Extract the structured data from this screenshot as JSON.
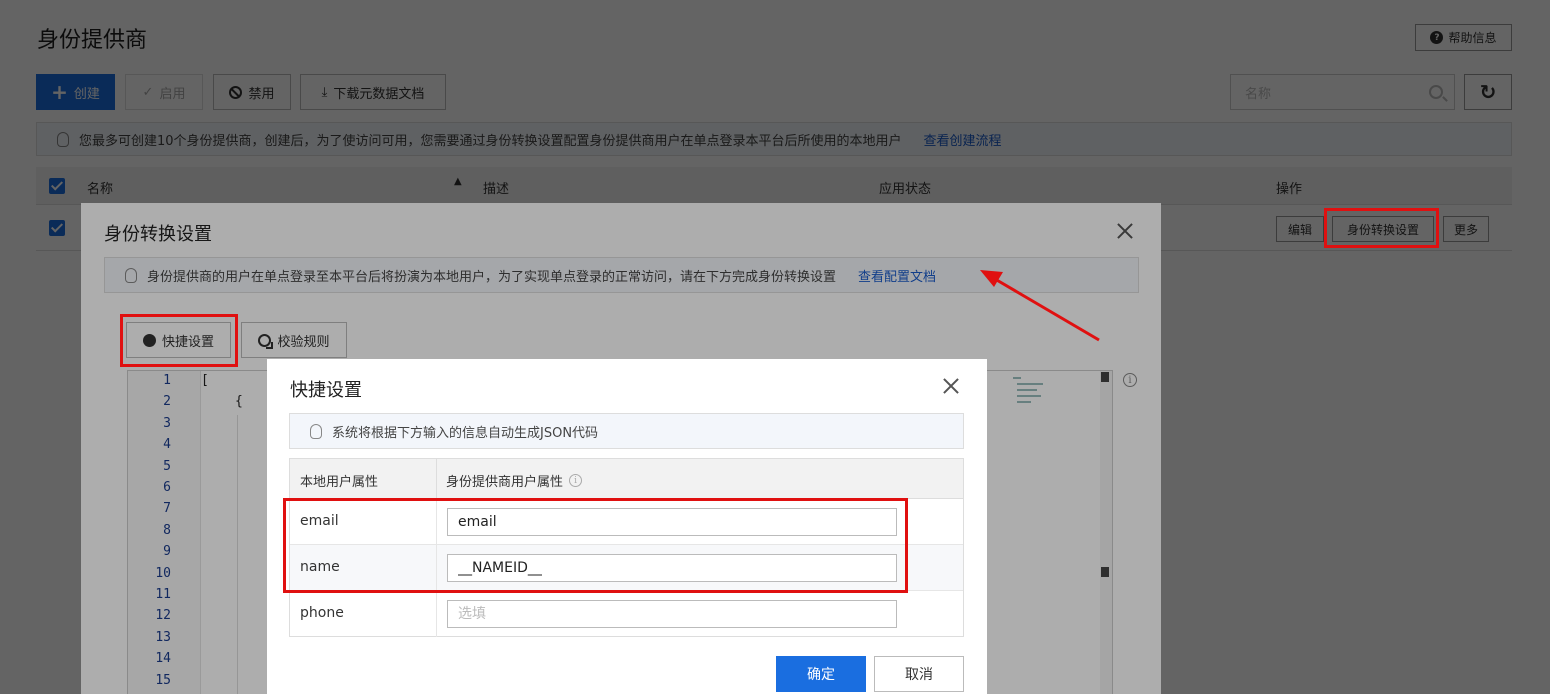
{
  "page": {
    "title": "身份提供商",
    "help_label": "帮助信息",
    "toolbar": {
      "create_label": "创建",
      "enable_label": "启用",
      "disable_label": "禁用",
      "download_label": "下载元数据文档"
    },
    "search": {
      "placeholder": "名称"
    },
    "notice": {
      "text": "您最多可创建10个身份提供商，创建后，为了使访问可用，您需要通过身份转换设置配置身份提供商用户在单点登录本平台后所使用的本地用户",
      "link": "查看创建流程"
    },
    "table": {
      "columns": [
        "名称",
        "描述",
        "应用状态",
        "操作"
      ],
      "row_actions": [
        "编辑",
        "身份转换设置",
        "更多"
      ]
    }
  },
  "dialog_identity": {
    "title": "身份转换设置",
    "notice_text": "身份提供商的用户在单点登录至本平台后将扮演为本地用户，为了实现单点登录的正常访问，请在下方完成身份转换设置",
    "notice_link": "查看配置文档",
    "quick_btn": "快捷设置",
    "rule_btn": "校验规则",
    "editor": {
      "line_numbers": [
        "1",
        "2",
        "3",
        "4",
        "5",
        "6",
        "7",
        "8",
        "9",
        "10",
        "11",
        "12",
        "13",
        "14",
        "15"
      ],
      "line1": "[",
      "line2": "{"
    }
  },
  "dialog_quick": {
    "title": "快捷设置",
    "notice": "系统将根据下方输入的信息自动生成JSON代码",
    "col_local": "本地用户属性",
    "col_idp": "身份提供商用户属性",
    "rows": [
      {
        "label": "email",
        "value": "email",
        "placeholder": ""
      },
      {
        "label": "name",
        "value": "__NAMEID__",
        "placeholder": ""
      },
      {
        "label": "phone",
        "value": "",
        "placeholder": "选填"
      }
    ],
    "ok_label": "确定",
    "cancel_label": "取消"
  },
  "colors": {
    "primary": "#1a6ee0",
    "link": "#1a5ccc",
    "annotation": "#e01010"
  }
}
